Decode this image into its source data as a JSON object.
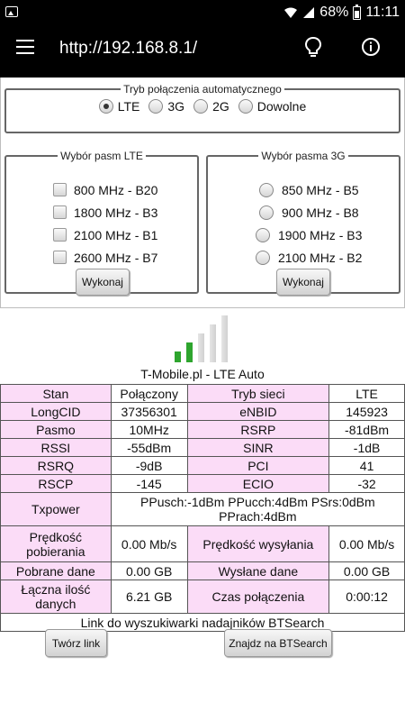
{
  "statusbar": {
    "battery": "68%",
    "time": "11:11"
  },
  "appbar": {
    "url": "http://192.168.8.1/"
  },
  "mode": {
    "legend": "Tryb połączenia automatycznego",
    "options": [
      "LTE",
      "3G",
      "2G",
      "Dowolne"
    ],
    "selected": "LTE"
  },
  "lte": {
    "legend": "Wybór pasm LTE",
    "bands": [
      "800 MHz - B20",
      "1800 MHz - B3",
      "2100 MHz - B1",
      "2600 MHz - B7"
    ],
    "button": "Wykonaj"
  },
  "g3": {
    "legend": "Wybór pasma 3G",
    "bands": [
      "850 MHz - B5",
      "900 MHz - B8",
      "1900 MHz - B3",
      "2100 MHz - B2"
    ],
    "button": "Wykonaj"
  },
  "signal": {
    "bars_total": 5,
    "bars_active": 2,
    "active_color": "#2ea52e",
    "inactive_color": "#d0d0d0"
  },
  "carrier": "T-Mobile.pl - LTE Auto",
  "table": {
    "stan_label": "Stan",
    "stan_value": "Połączony",
    "tryb_label": "Tryb sieci",
    "tryb_value": "LTE",
    "longcid_label": "LongCID",
    "longcid_value": "37356301",
    "enbid_label": "eNBID",
    "enbid_value": "145923",
    "pasmo_label": "Pasmo",
    "pasmo_value": "10MHz",
    "rsrp_label": "RSRP",
    "rsrp_value": "-81dBm",
    "rssi_label": "RSSI",
    "rssi_value": "-55dBm",
    "sinr_label": "SINR",
    "sinr_value": "-1dB",
    "rsrq_label": "RSRQ",
    "rsrq_value": "-9dB",
    "pci_label": "PCI",
    "pci_value": "41",
    "rscp_label": "RSCP",
    "rscp_value": "-145",
    "ecio_label": "ECIO",
    "ecio_value": "-32",
    "txpower_label": "Txpower",
    "txpower_value": "PPusch:-1dBm PPucch:4dBm PSrs:0dBm PPrach:4dBm",
    "dl_speed_label": "Prędkość pobierania",
    "dl_speed_value": "0.00 Mb/s",
    "ul_speed_label": "Prędkość wysyłania",
    "ul_speed_value": "0.00 Mb/s",
    "dl_data_label": "Pobrane dane",
    "dl_data_value": "0.00 GB",
    "ul_data_label": "Wysłane dane",
    "ul_data_value": "0.00 GB",
    "total_label": "Łączna ilość danych",
    "total_value": "6.21 GB",
    "time_label": "Czas połączenia",
    "time_value": "0:00:12",
    "btsearch_link": "Link do wyszukiwarki nadajników BTSearch"
  },
  "buttons": {
    "create_link": "Twórz link",
    "find_btsearch": "Znajdz na BTSearch"
  }
}
